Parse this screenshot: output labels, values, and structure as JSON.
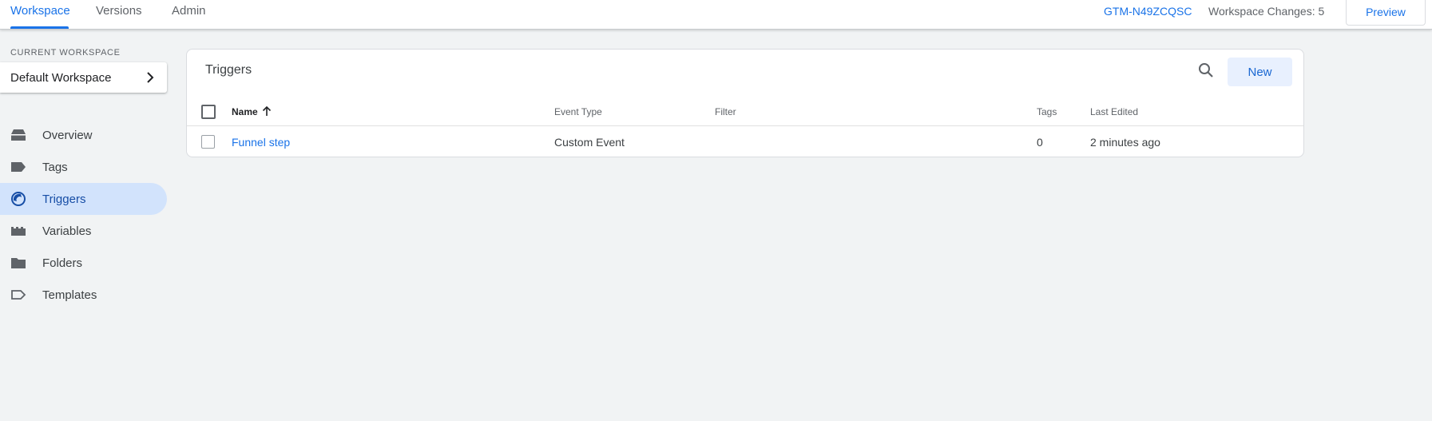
{
  "topbar": {
    "tabs": [
      {
        "label": "Workspace",
        "active": true
      },
      {
        "label": "Versions",
        "active": false
      },
      {
        "label": "Admin",
        "active": false
      }
    ],
    "container_id": "GTM-N49ZCQSC",
    "workspace_changes": "Workspace Changes: 5",
    "preview_label": "Preview"
  },
  "sidebar": {
    "current_workspace_caption": "CURRENT WORKSPACE",
    "workspace_name": "Default Workspace",
    "items": [
      {
        "label": "Overview",
        "icon": "overview-icon"
      },
      {
        "label": "Tags",
        "icon": "tag-icon"
      },
      {
        "label": "Triggers",
        "icon": "trigger-icon",
        "active": true
      },
      {
        "label": "Variables",
        "icon": "variables-icon"
      },
      {
        "label": "Folders",
        "icon": "folder-icon"
      },
      {
        "label": "Templates",
        "icon": "template-icon"
      }
    ]
  },
  "main": {
    "title": "Triggers",
    "new_label": "New",
    "columns": [
      "Name",
      "Event Type",
      "Filter",
      "Tags",
      "Last Edited"
    ],
    "rows": [
      {
        "name": "Funnel step",
        "event_type": "Custom Event",
        "filter": "",
        "tags": "0",
        "last_edited": "2 minutes ago"
      }
    ]
  },
  "colors": {
    "accent": "#1a73e8",
    "active_nav_bg": "#d2e3fc",
    "page_bg": "#f1f3f4"
  }
}
